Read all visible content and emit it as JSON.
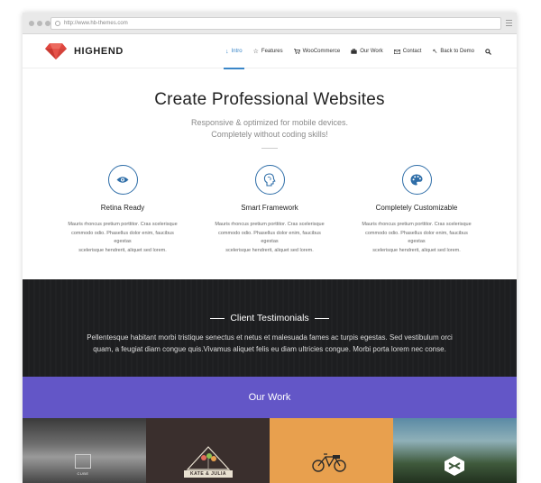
{
  "browser": {
    "url": "http://www.hb-themes.com"
  },
  "header": {
    "brand": "HIGHEND",
    "nav": [
      {
        "label": "Intro",
        "icon": "arrow-down-icon",
        "active": true
      },
      {
        "label": "Features",
        "icon": "star-icon",
        "active": false
      },
      {
        "label": "WooCommerce",
        "icon": "cart-icon",
        "active": false
      },
      {
        "label": "Our Work",
        "icon": "briefcase-icon",
        "active": false
      },
      {
        "label": "Contact",
        "icon": "envelope-icon",
        "active": false
      },
      {
        "label": "Back to Demo",
        "icon": "back-arrow-icon",
        "active": false
      }
    ],
    "search_icon": "search-icon"
  },
  "hero": {
    "title": "Create Professional Websites",
    "subtitle_line1": "Responsive & optimized for mobile devices.",
    "subtitle_line2": "Completely without coding skills!"
  },
  "features": [
    {
      "icon": "eye-icon",
      "title": "Retina Ready",
      "text_line1": "Mauris rhoncus pretium porttitor. Cras scelerisque",
      "text_line2": "commodo odio. Phasellus dolor enim, faucibus egestas",
      "text_line3": "scelerisque hendrerit, aliquet sed lorem."
    },
    {
      "icon": "brain-icon",
      "title": "Smart Framework",
      "text_line1": "Mauris rhoncus pretium porttitor. Cras scelerisque",
      "text_line2": "commodo odio. Phasellus dolor enim, faucibus egestas",
      "text_line3": "scelerisque hendrerit, aliquet sed lorem."
    },
    {
      "icon": "palette-icon",
      "title": "Completely Customizable",
      "text_line1": "Mauris rhoncus pretium porttitor. Cras scelerisque",
      "text_line2": "commodo odio. Phasellus dolor enim, faucibus egestas",
      "text_line3": "scelerisque hendrerit, aliquet sed lorem."
    }
  ],
  "testimonials": {
    "title": "Client Testimonials",
    "text_line1": "Pellentesque habitant morbi tristique senectus et netus et malesuada fames ac turpis egestas. Sed vestibulum orci",
    "text_line2": "quam, a feugiat diam congue quis.Vivamus aliquet felis eu diam ultricies congue. Morbi porta lorem nec conse."
  },
  "work": {
    "title": "Our Work"
  },
  "portfolio": [
    {
      "name": "cube",
      "caption": "CUBE"
    },
    {
      "name": "kate-julia",
      "caption": "KATE & JULIA"
    },
    {
      "name": "bicycle",
      "caption": ""
    },
    {
      "name": "landscape",
      "caption": ""
    }
  ],
  "colors": {
    "accent": "#3a86c8",
    "feature_icon": "#2f6ea8",
    "work_band": "#6356c7",
    "testimonial_bg": "#1d1e20",
    "logo_red": "#e0473f"
  }
}
